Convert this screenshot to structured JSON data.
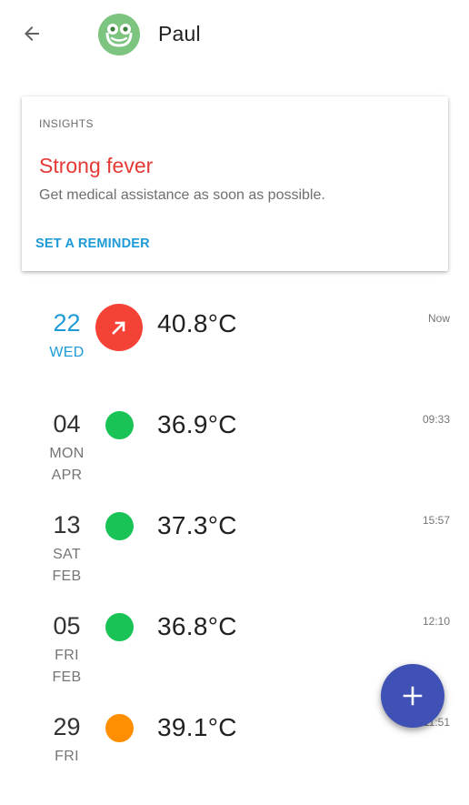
{
  "header": {
    "back_icon": "arrow-left-icon",
    "avatar_icon": "frog-face-icon",
    "avatar_color": "#7cc47f",
    "name": "Paul"
  },
  "insights": {
    "header": "INSIGHTS",
    "title": "Strong fever",
    "body": "Get medical assistance as soon as possible.",
    "action": "SET A REMINDER",
    "title_color": "#e53935",
    "action_color": "#1e9bd7"
  },
  "readings": [
    {
      "day": "22",
      "weekday": "WED",
      "month": "",
      "temperature": "40.8°C",
      "time": "Now",
      "status": "high",
      "status_icon": "arrow-up-right-icon",
      "status_color": "#f44336"
    },
    {
      "day": "04",
      "weekday": "MON",
      "month": "APR",
      "temperature": "36.9°C",
      "time": "09:33",
      "status": "normal",
      "status_color": "#19c356"
    },
    {
      "day": "13",
      "weekday": "SAT",
      "month": "FEB",
      "temperature": "37.3°C",
      "time": "15:57",
      "status": "normal",
      "status_color": "#19c356"
    },
    {
      "day": "05",
      "weekday": "FRI",
      "month": "FEB",
      "temperature": "36.8°C",
      "time": "12:10",
      "status": "normal",
      "status_color": "#19c356"
    },
    {
      "day": "29",
      "weekday": "FRI",
      "month": "",
      "temperature": "39.1°C",
      "time": "11:51",
      "status": "fever",
      "status_color": "#ff8f00"
    }
  ],
  "fab": {
    "icon": "plus-icon",
    "color": "#3f51b5"
  }
}
